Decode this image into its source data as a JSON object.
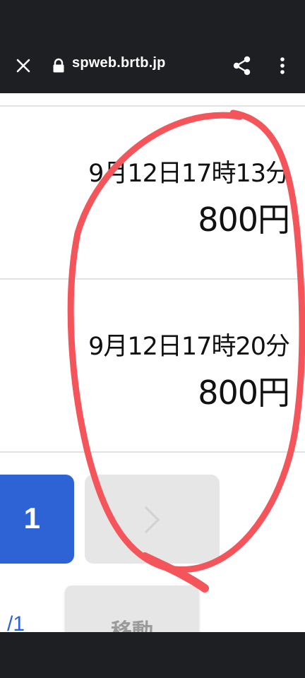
{
  "browser": {
    "url": "spweb.brtb.jp",
    "icons": [
      "close-icon",
      "lock-icon",
      "share-icon",
      "more-vert-icon"
    ]
  },
  "entries": [
    {
      "time": "9月12日17時13分",
      "price": "800円"
    },
    {
      "time": "9月12日17時20分",
      "price": "800円"
    }
  ],
  "pagination": {
    "current_page": "1",
    "page_count_fragment": "/1",
    "move_button": "移動"
  },
  "colors": {
    "browser_bar": "#1e1f22",
    "accent": "#2d63d4",
    "disabled_button": "#e6e6e6",
    "annotation_stroke": "#f4555b"
  }
}
